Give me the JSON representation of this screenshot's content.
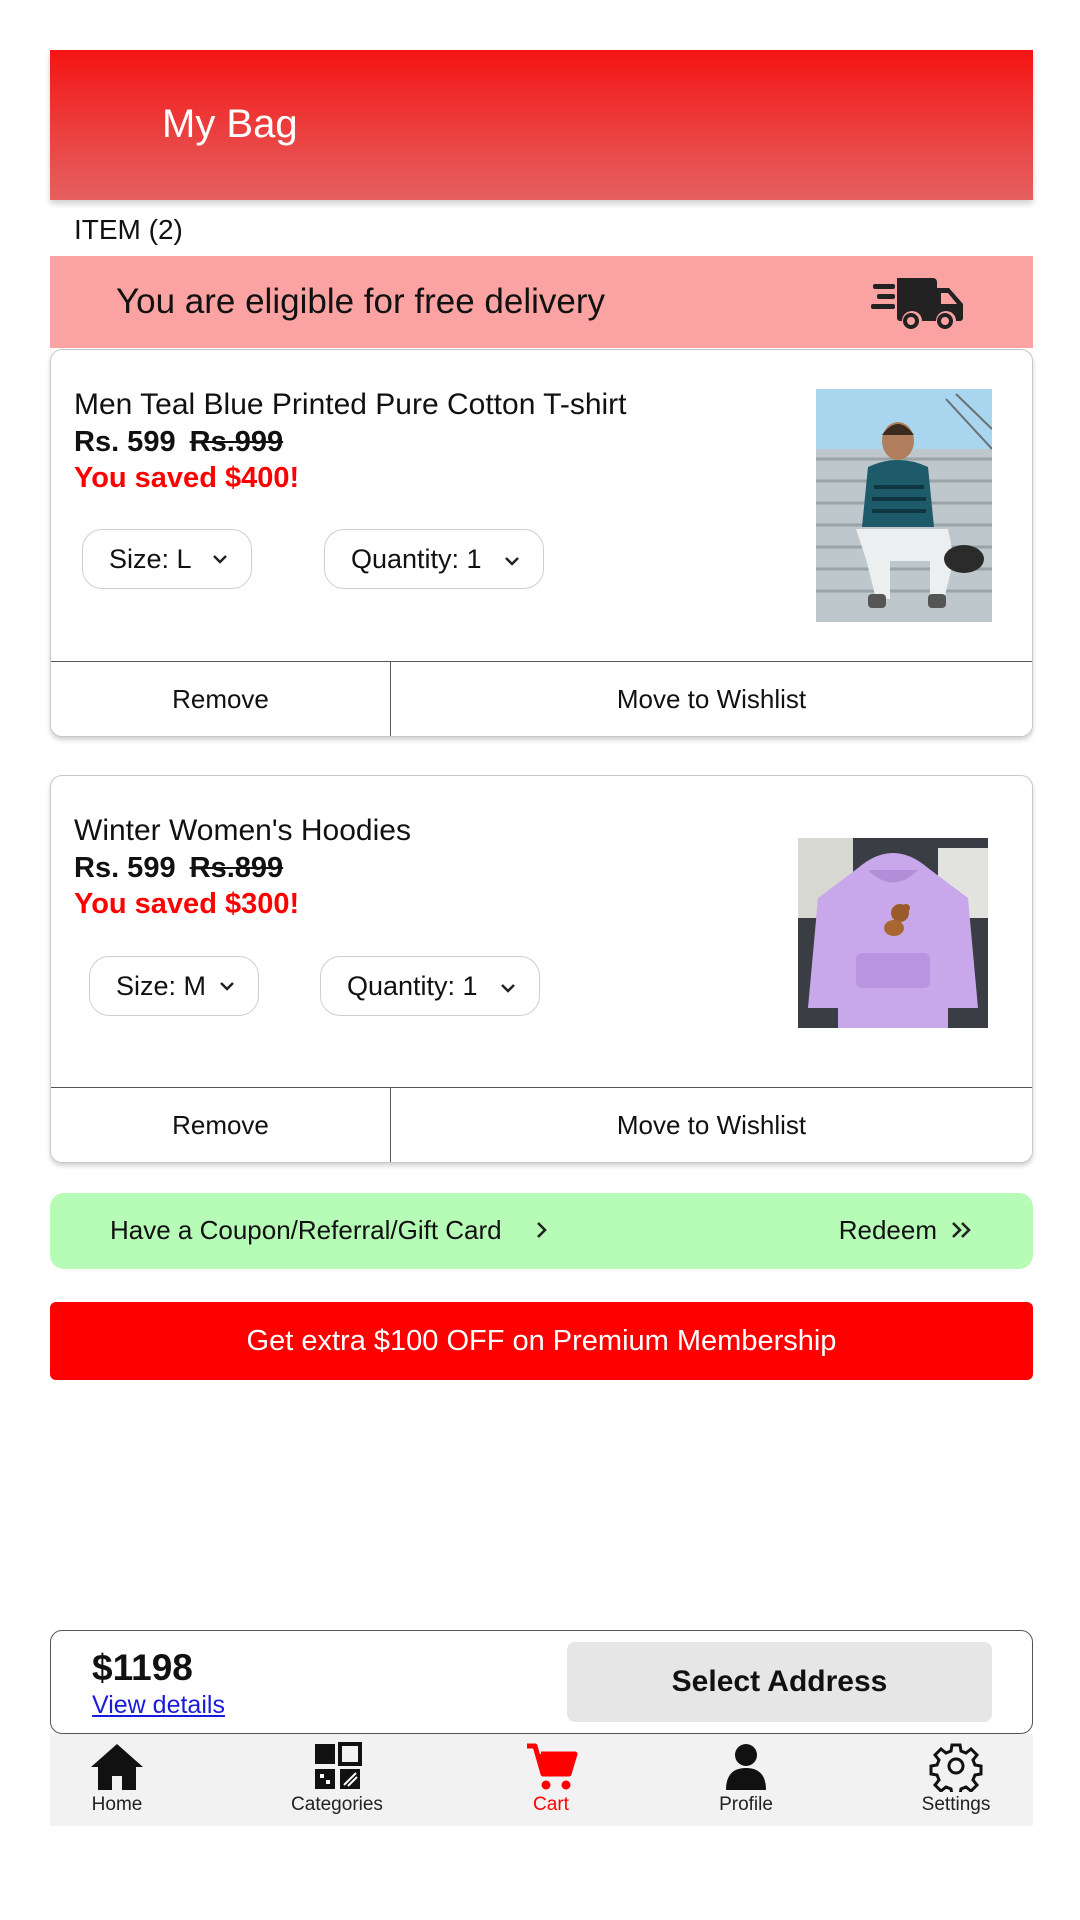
{
  "header": {
    "title": "My Bag",
    "background": "#f51414"
  },
  "items_count": "ITEM (2)",
  "delivery": {
    "text": "You are eligible for free delivery",
    "icon": "truck-icon",
    "background": "#fba3a3"
  },
  "cart_items": [
    {
      "name": "Men Teal Blue Printed Pure Cotton T-shirt",
      "price": "Rs. 599",
      "old_price": "Rs.999",
      "saved": "You saved $400!",
      "size_label": "Size: L",
      "quantity_label": "Quantity: 1",
      "remove_label": "Remove",
      "wishlist_label": "Move to Wishlist",
      "image_icon": "product-photo-man-tshirt"
    },
    {
      "name": "Winter Women's Hoodies",
      "price": "Rs. 599",
      "old_price": "Rs.899",
      "saved": "You saved $300!",
      "size_label": "Size: M",
      "quantity_label": "Quantity: 1",
      "remove_label": "Remove",
      "wishlist_label": "Move to Wishlist",
      "image_icon": "product-photo-purple-hoodie"
    }
  ],
  "coupon": {
    "text": "Have a Coupon/Referral/Gift Card",
    "redeem_label": "Redeem",
    "background": "#b6fbb6"
  },
  "premium": {
    "text": "Get extra $100 OFF on Premium Membership",
    "background": "#ff0000"
  },
  "checkout": {
    "total": "$1198",
    "view_details": "View details",
    "select_address": "Select Address"
  },
  "nav": {
    "items": [
      {
        "label": "Home",
        "icon": "home-icon"
      },
      {
        "label": "Categories",
        "icon": "categories-icon"
      },
      {
        "label": "Cart",
        "icon": "cart-icon",
        "active": true
      },
      {
        "label": "Profile",
        "icon": "profile-icon"
      },
      {
        "label": "Settings",
        "icon": "settings-icon"
      }
    ],
    "active_color": "#ff0000"
  }
}
